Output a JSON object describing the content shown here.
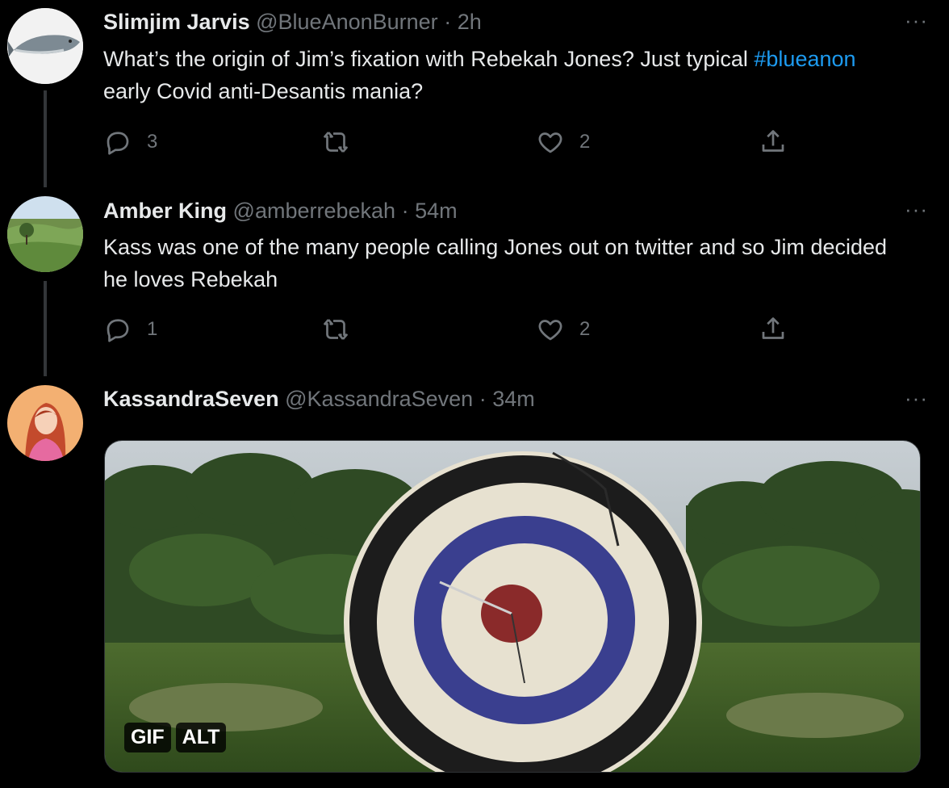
{
  "tweets": [
    {
      "name": "Slimjim Jarvis",
      "handle": "@BlueAnonBurner",
      "separator": "·",
      "time": "2h",
      "more": "···",
      "text_parts": {
        "before": "What’s the origin of Jim’s fixation with Rebekah Jones? Just typical ",
        "hashtag": "#blueanon",
        "after": " early Covid anti-Desantis mania?"
      },
      "reply_count": "3",
      "retweet_count": "",
      "like_count": "2"
    },
    {
      "name": "Amber King",
      "handle": "@amberrebekah",
      "separator": "·",
      "time": "54m",
      "more": "···",
      "text": "Kass was one of the many people calling Jones out on twitter and so Jim decided he loves Rebekah",
      "reply_count": "1",
      "retweet_count": "",
      "like_count": "2"
    },
    {
      "name": "KassandraSeven",
      "handle": "@KassandraSeven",
      "separator": "·",
      "time": "34m",
      "more": "···",
      "media": {
        "gif_badge": "GIF",
        "alt_badge": "ALT"
      }
    }
  ],
  "icons": {
    "reply": "reply-icon",
    "retweet": "retweet-icon",
    "like": "heart-icon",
    "share": "share-icon"
  },
  "colors": {
    "background": "#000000",
    "text": "#e7e9ea",
    "secondary": "#71767b",
    "link": "#1d9bf0",
    "thread_line": "#333639"
  }
}
